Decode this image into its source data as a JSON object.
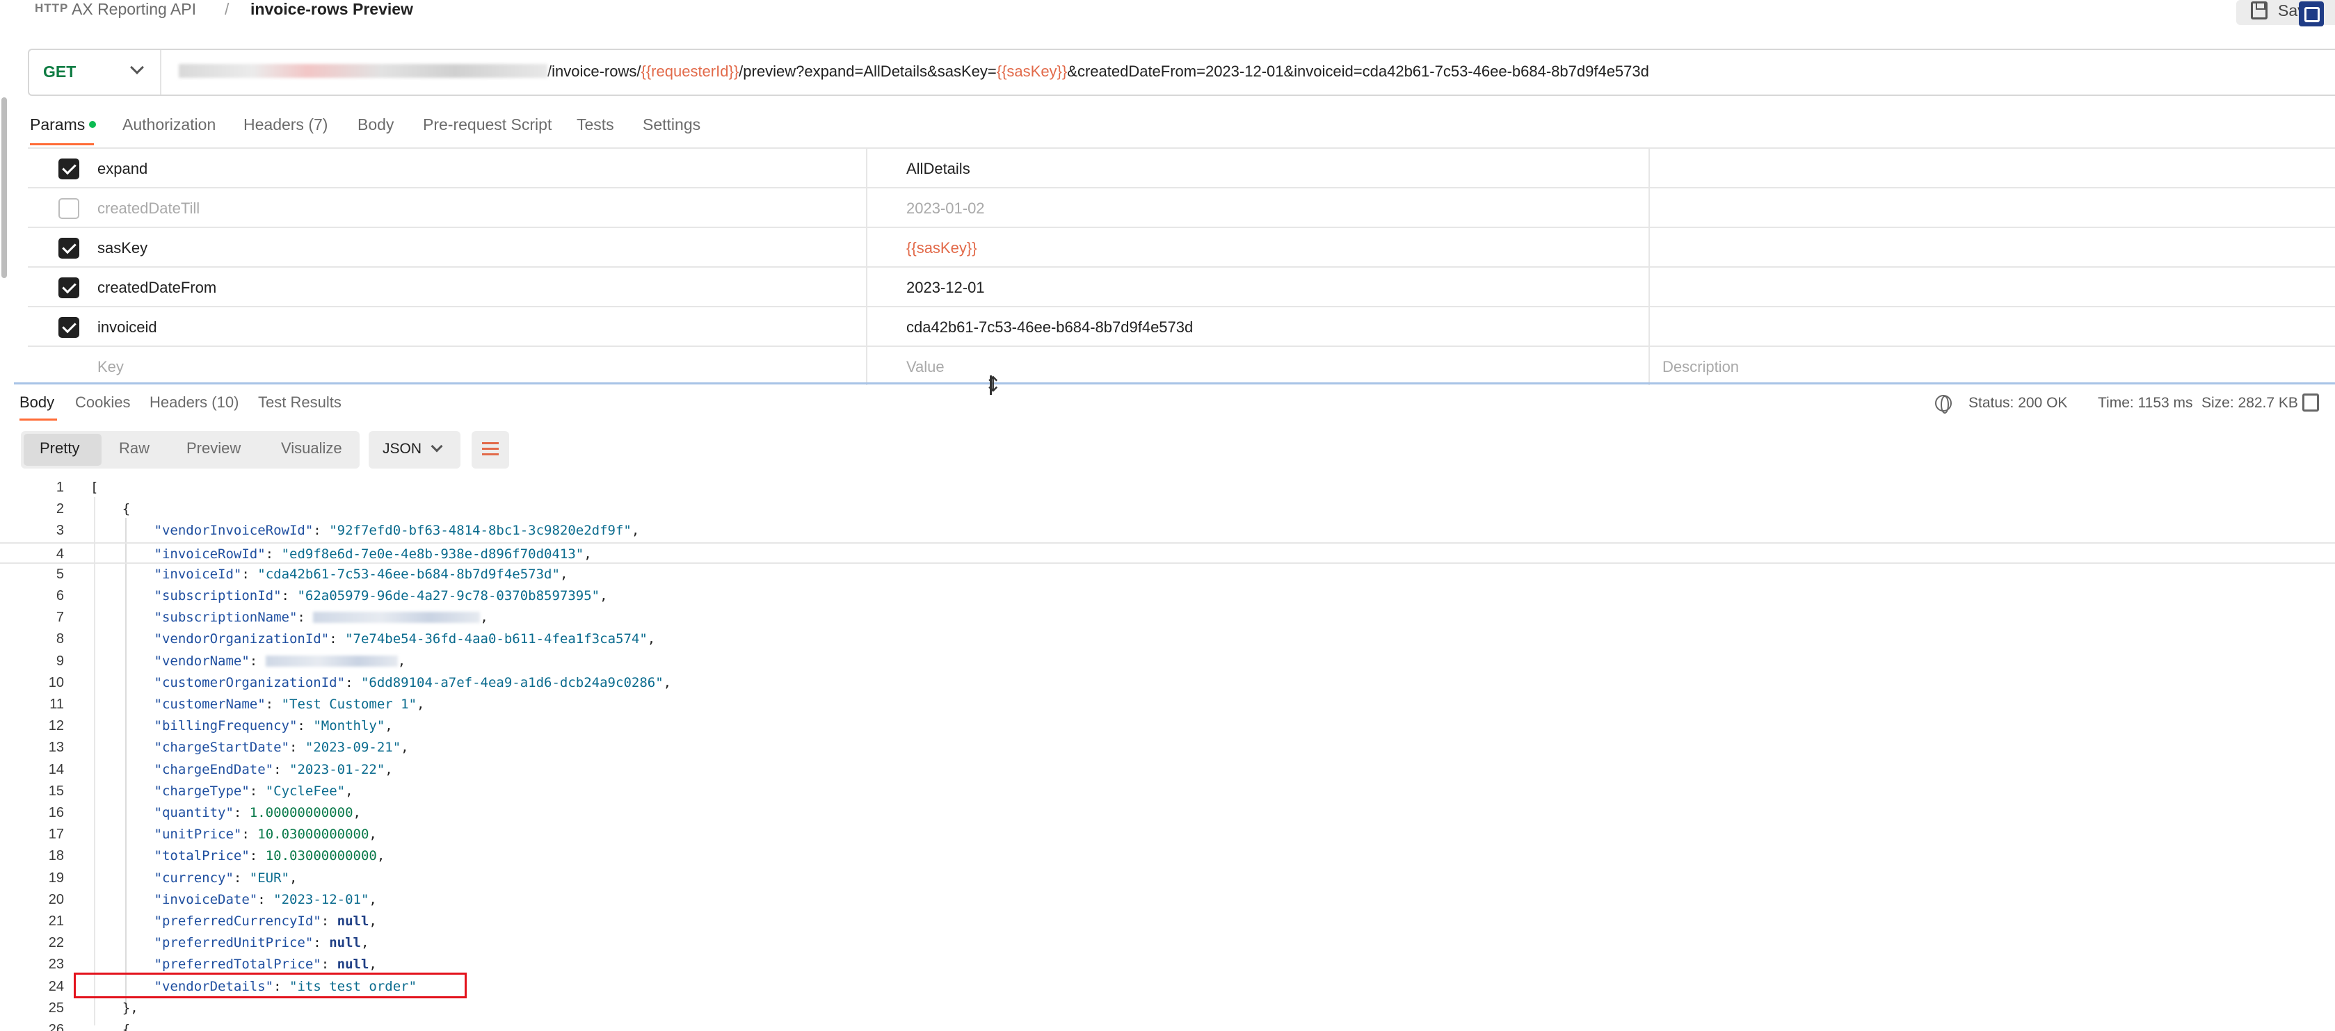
{
  "header": {
    "http_badge": "HTTP",
    "collection": "AX Reporting API",
    "separator": "/",
    "title": "invoice-rows Preview",
    "save_label": "Save"
  },
  "request": {
    "method": "GET",
    "url_parts": {
      "p1": "/invoice-rows/",
      "v1": "{{requesterId}}",
      "p2": "/preview?expand=AllDetails&sasKey=",
      "v2": "{{sasKey}}",
      "p3": "&createdDateFrom=2023-12-01&invoiceid=cda42b61-7c53-46ee-b684-8b7d9f4e573d"
    }
  },
  "request_tabs": [
    "Params",
    "Authorization",
    "Headers (7)",
    "Body",
    "Pre-request Script",
    "Tests",
    "Settings"
  ],
  "params": [
    {
      "key": "expand",
      "value": "AllDetails",
      "checked": true
    },
    {
      "key": "createdDateTill",
      "value": "2023-01-02",
      "checked": false
    },
    {
      "key": "sasKey",
      "value": "{{sasKey}}",
      "checked": true
    },
    {
      "key": "createdDateFrom",
      "value": "2023-12-01",
      "checked": true
    },
    {
      "key": "invoiceid",
      "value": "cda42b61-7c53-46ee-b684-8b7d9f4e573d",
      "checked": true
    }
  ],
  "params_placeholders": {
    "key": "Key",
    "value": "Value",
    "description": "Description"
  },
  "response_tabs": [
    "Body",
    "Cookies",
    "Headers (10)",
    "Test Results"
  ],
  "response_status": {
    "status": "Status: 200 OK",
    "time": "Time: 1153 ms",
    "size": "Size: 282.7 KB"
  },
  "view_modes": [
    "Pretty",
    "Raw",
    "Preview",
    "Visualize"
  ],
  "format": "JSON",
  "code_lines": [
    {
      "n": "1",
      "t": "["
    },
    {
      "n": "2",
      "t": "    {"
    },
    {
      "n": "3",
      "k": "\"vendorInvoiceRowId\"",
      "v": "\"92f7efd0-bf63-4814-8bc1-3c9820e2df9f\"",
      "vt": "s"
    },
    {
      "n": "4",
      "k": "\"invoiceRowId\"",
      "v": "\"ed9f8e6d-7e0e-4e8b-938e-d896f70d0413\"",
      "vt": "s"
    },
    {
      "n": "5",
      "k": "\"invoiceId\"",
      "v": "\"cda42b61-7c53-46ee-b684-8b7d9f4e573d\"",
      "vt": "s"
    },
    {
      "n": "6",
      "k": "\"subscriptionId\"",
      "v": "\"62a05979-96de-4a27-9c78-0370b8597395\"",
      "vt": "s"
    },
    {
      "n": "7",
      "k": "\"subscriptionName\"",
      "v": "",
      "vt": "blur"
    },
    {
      "n": "8",
      "k": "\"vendorOrganizationId\"",
      "v": "\"7e74be54-36fd-4aa0-b611-4fea1f3ca574\"",
      "vt": "s"
    },
    {
      "n": "9",
      "k": "\"vendorName\"",
      "v": "",
      "vt": "blur"
    },
    {
      "n": "10",
      "k": "\"customerOrganizationId\"",
      "v": "\"6dd89104-a7ef-4ea9-a1d6-dcb24a9c0286\"",
      "vt": "s"
    },
    {
      "n": "11",
      "k": "\"customerName\"",
      "v": "\"Test Customer 1\"",
      "vt": "s"
    },
    {
      "n": "12",
      "k": "\"billingFrequency\"",
      "v": "\"Monthly\"",
      "vt": "s"
    },
    {
      "n": "13",
      "k": "\"chargeStartDate\"",
      "v": "\"2023-09-21\"",
      "vt": "s"
    },
    {
      "n": "14",
      "k": "\"chargeEndDate\"",
      "v": "\"2023-01-22\"",
      "vt": "s"
    },
    {
      "n": "15",
      "k": "\"chargeType\"",
      "v": "\"CycleFee\"",
      "vt": "s"
    },
    {
      "n": "16",
      "k": "\"quantity\"",
      "v": "1.00000000000",
      "vt": "n"
    },
    {
      "n": "17",
      "k": "\"unitPrice\"",
      "v": "10.03000000000",
      "vt": "n"
    },
    {
      "n": "18",
      "k": "\"totalPrice\"",
      "v": "10.03000000000",
      "vt": "n"
    },
    {
      "n": "19",
      "k": "\"currency\"",
      "v": "\"EUR\"",
      "vt": "s"
    },
    {
      "n": "20",
      "k": "\"invoiceDate\"",
      "v": "\"2023-12-01\"",
      "vt": "s"
    },
    {
      "n": "21",
      "k": "\"preferredCurrencyId\"",
      "v": "null",
      "vt": "nl"
    },
    {
      "n": "22",
      "k": "\"preferredUnitPrice\"",
      "v": "null",
      "vt": "nl"
    },
    {
      "n": "23",
      "k": "\"preferredTotalPrice\"",
      "v": "null",
      "vt": "nl"
    },
    {
      "n": "24",
      "k": "\"vendorDetails\"",
      "v": "\"its test order\"",
      "vt": "s",
      "last": true
    },
    {
      "n": "25",
      "t": "    },"
    },
    {
      "n": "26",
      "t": "    {"
    }
  ]
}
